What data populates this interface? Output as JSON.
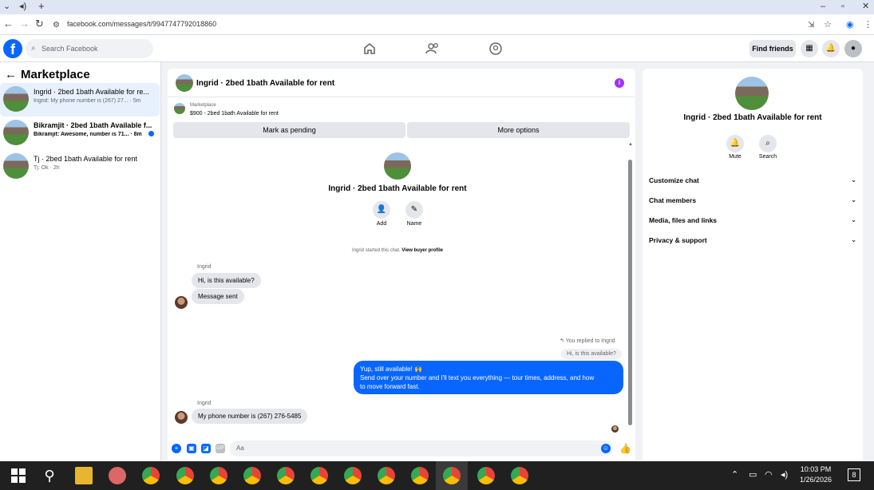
{
  "browser": {
    "url": "facebook.com/messages/t/9947747792018860",
    "back_icon": "arrow-left-icon",
    "forward_icon": "arrow-right-icon",
    "reload_icon": "reload-icon"
  },
  "header": {
    "search_placeholder": "Search Facebook",
    "find_friends": "Find friends"
  },
  "sidebar": {
    "title": "Marketplace",
    "conversations": [
      {
        "name": "Ingrid · 2bed 1bath Available for re...",
        "preview": "Ingrid: My phone number is (267) 27... · 5m",
        "selected": true,
        "unread": false
      },
      {
        "name": "Bikramjit · 2bed 1bath Available f...",
        "preview": "Bikramjit: Awesome, number is 71... · 8m",
        "selected": false,
        "unread": true
      },
      {
        "name": "Tj · 2bed 1bath Available for rent",
        "preview": "Tj: Ok · 2h",
        "selected": false,
        "unread": false
      }
    ]
  },
  "chat": {
    "title": "Ingrid · 2bed 1bath Available for rent",
    "marketplace_label": "Marketplace",
    "listing": "$900 - 2bed 1bath Available for rent",
    "mark_pending": "Mark as pending",
    "more_options": "More options",
    "intro_title": "Ingrid · 2bed 1bath Available for rent",
    "add_label": "Add",
    "name_label": "Name",
    "started_text": "Ingrid started this chat.",
    "view_profile": "View buyer profile",
    "sender1": "Ingrid",
    "msg1": "Hi, is this available?",
    "msg2": "Message sent",
    "replied_label": "You replied to Ingrid",
    "quoted": "Hi, is this available?",
    "out_line1": "Yup, still available! 🙌",
    "out_line2": "Send over your number and I'll text you everything — tour times, address, and how",
    "out_line3": "to move forward fast.",
    "sender2": "Ingrid",
    "msg3": "My phone number is (267) 276-5485",
    "composer_placeholder": "Aa"
  },
  "info_panel": {
    "title": "Ingrid · 2bed 1bath Available for rent",
    "mute": "Mute",
    "search": "Search",
    "sections": [
      "Customize chat",
      "Chat members",
      "Media, files and links",
      "Privacy & support"
    ]
  },
  "taskbar": {
    "time": "10:03 PM",
    "date": "1/26/2026",
    "notification_count": "8"
  },
  "colors": {
    "accent": "#0866ff",
    "info_purple": "#a033ff"
  }
}
